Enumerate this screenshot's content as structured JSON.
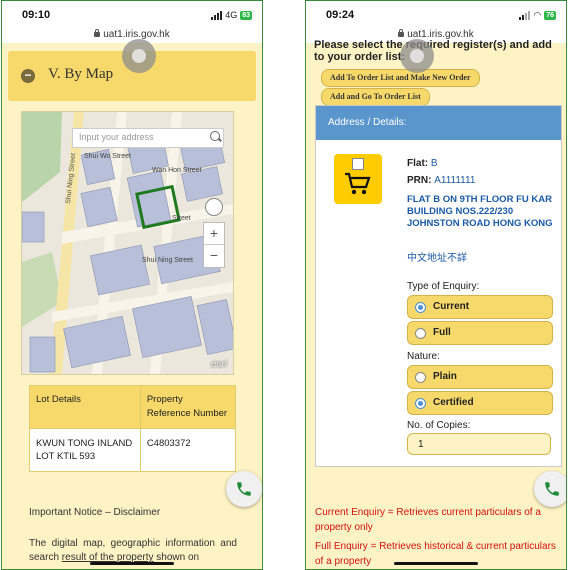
{
  "left": {
    "time": "09:10",
    "network": "4G",
    "battery": "83",
    "url": "uat1.iris.gov.hk",
    "section_title": "V. By Map",
    "collapse_symbol": "−",
    "map": {
      "search_placeholder": "Input your address",
      "attribution": "esri",
      "street_labels": [
        "Shui Ning Street",
        "Shui Wo Street",
        "Shui Ning Street",
        "Wan Hon Street",
        "Street"
      ]
    },
    "table": {
      "col1_header": "Lot Details",
      "col2_header": "Property Reference Number",
      "lot": "KWUN TONG INLAND LOT KTIL 593",
      "prn": "C4803372"
    },
    "notice": "Important Notice – Disclaimer",
    "paragraph_a": "The digital map, geographic information and search ",
    "paragraph_link": "result of the property",
    "paragraph_b": " shown on"
  },
  "right": {
    "time": "09:24",
    "battery": "76",
    "url": "uat1.iris.gov.hk",
    "instruction": "Please select the required register(s) and add to your order list:",
    "btn_add_new": "Add To Order List and Make New Order",
    "btn_add_go": "Add and Go To Order List",
    "panel_title": "Address / Details:",
    "flat_label": "Flat:",
    "flat_value": "B",
    "prn_label": "PRN:",
    "prn_value": "A1111111",
    "address": "FLAT B ON 9TH FLOOR FU KAR BUILDING NOS.222/230 JOHNSTON ROAD HONG KONG",
    "address_cn": "中文地址不詳",
    "enquiry_label": "Type of Enquiry:",
    "enquiry_options": [
      {
        "label": "Current",
        "selected": true
      },
      {
        "label": "Full",
        "selected": false
      }
    ],
    "nature_label": "Nature:",
    "nature_options": [
      {
        "label": "Plain",
        "selected": false
      },
      {
        "label": "Certified",
        "selected": true
      }
    ],
    "copies_label": "No. of Copies:",
    "copies_value": "1",
    "note_current": "Current Enquiry = Retrieves current particulars of a property only",
    "note_full": "Full Enquiry = Retrieves historical & current particulars of a property"
  },
  "colors": {
    "accent_yellow": "#f6d96a",
    "panel_blue": "#5a96cc",
    "link_blue": "#1a5aa8",
    "notice_red": "#d01010",
    "call_green": "#1f8a3a"
  }
}
